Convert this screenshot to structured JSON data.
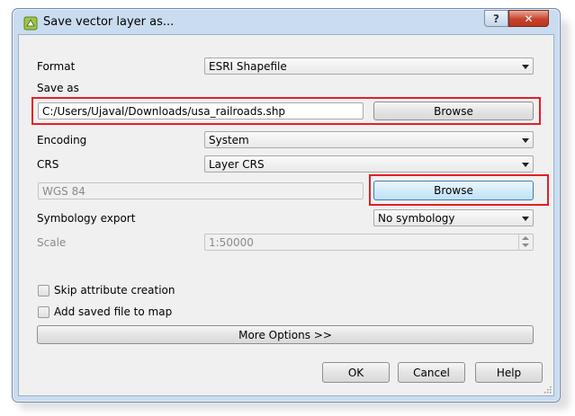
{
  "window": {
    "title": "Save vector layer as...",
    "help_label": "?",
    "close_label": "✕"
  },
  "form": {
    "format_label": "Format",
    "format_value": "ESRI Shapefile",
    "save_as_label": "Save as",
    "save_as_value": "C:/Users/Ujaval/Downloads/usa_railroads.shp",
    "browse_file_label": "Browse",
    "encoding_label": "Encoding",
    "encoding_value": "System",
    "crs_label": "CRS",
    "crs_value": "Layer CRS",
    "crs_text": "WGS 84",
    "browse_crs_label": "Browse",
    "symbology_label": "Symbology export",
    "symbology_value": "No symbology",
    "scale_label": "Scale",
    "scale_value": "1:50000",
    "skip_attr_label": "Skip attribute creation",
    "add_to_map_label": "Add saved file to map",
    "more_options_label": "More Options >>"
  },
  "buttons": {
    "ok": "OK",
    "cancel": "Cancel",
    "help": "Help"
  },
  "colors": {
    "highlight": "#e31f27",
    "focus_border": "#3c7fb1",
    "titlebar": "#c9dcf0"
  },
  "icons": {
    "app": "qgis-icon",
    "help": "question-icon",
    "close": "close-icon"
  }
}
